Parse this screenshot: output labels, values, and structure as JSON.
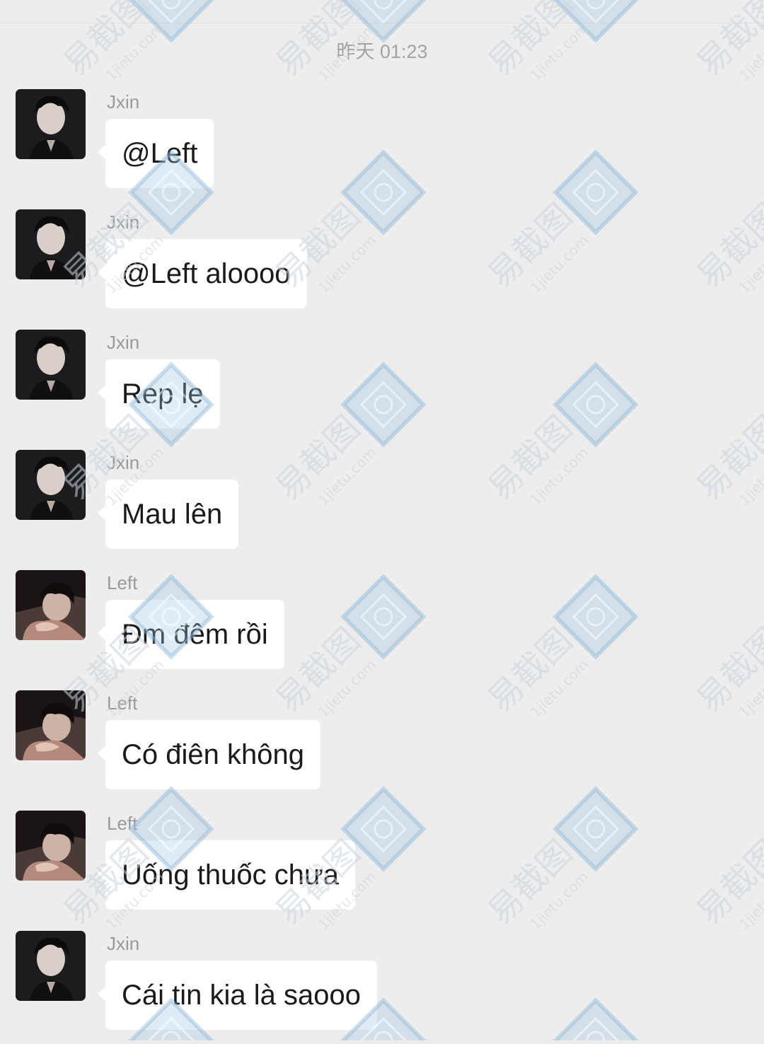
{
  "chat": {
    "timestamp": "昨天 01:23",
    "messages": [
      {
        "sender": "Jxin",
        "text": "@Left",
        "avatar": "jxin-avatar"
      },
      {
        "sender": "Jxin",
        "text": "@Left aloooo",
        "avatar": "jxin-avatar"
      },
      {
        "sender": "Jxin",
        "text": "Rep lẹ",
        "avatar": "jxin-avatar"
      },
      {
        "sender": "Jxin",
        "text": "Mau lên",
        "avatar": "jxin-avatar"
      },
      {
        "sender": "Left",
        "text": "Đm đêm rồi",
        "avatar": "left-avatar"
      },
      {
        "sender": "Left",
        "text": "Có điên không",
        "avatar": "left-avatar"
      },
      {
        "sender": "Left",
        "text": "Uống thuốc chưa",
        "avatar": "left-avatar"
      },
      {
        "sender": "Jxin",
        "text": "Cái tin kia là saooo",
        "avatar": "jxin-avatar"
      }
    ]
  },
  "watermark": {
    "brand": "易截图",
    "domain": "1jietu.com"
  },
  "colors": {
    "background": "#ededed",
    "bubble": "#ffffff",
    "sender_name": "#9a9a9a",
    "timestamp": "#a3a3a3"
  }
}
